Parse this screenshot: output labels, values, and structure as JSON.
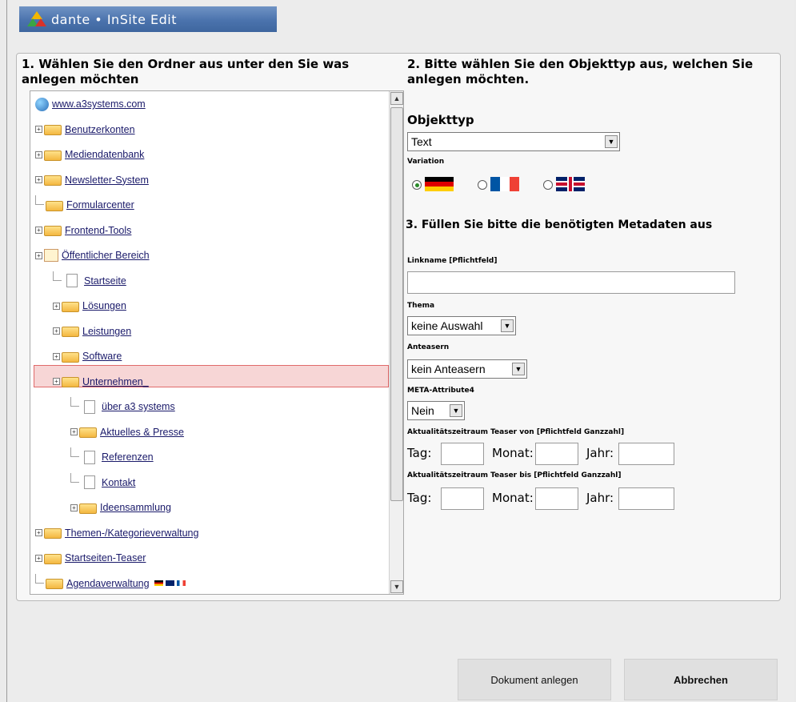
{
  "app": {
    "title": "dante • InSite Edit"
  },
  "left": {
    "title": "1. Wählen Sie den Ordner aus unter den Sie was anlegen möchten",
    "tree": [
      {
        "label": "www.a3systems.com",
        "icon": "globe-icon"
      },
      {
        "label": "Benutzerkonten",
        "icon": "users-icon"
      },
      {
        "label": "Mediendatenbank",
        "icon": "media-icon"
      },
      {
        "label": "Newsletter-System",
        "icon": "folder-icon"
      },
      {
        "label": "Formularcenter",
        "icon": "folder-icon"
      },
      {
        "label": "Frontend-Tools",
        "icon": "tools-icon"
      },
      {
        "label": "Öffentlicher Bereich",
        "icon": "home-icon"
      },
      {
        "label": "Startseite",
        "icon": "page-icon"
      },
      {
        "label": "Lösungen",
        "icon": "folder-icon"
      },
      {
        "label": "Leistungen",
        "icon": "folder-icon"
      },
      {
        "label": "Software",
        "icon": "folder-icon"
      },
      {
        "label": "Unternehmen_",
        "icon": "folder-icon"
      },
      {
        "label": "über a3 systems",
        "icon": "page-icon"
      },
      {
        "label": "Aktuelles & Presse",
        "icon": "folder-icon"
      },
      {
        "label": "Referenzen",
        "icon": "page-icon"
      },
      {
        "label": "Kontakt",
        "icon": "page-icon"
      },
      {
        "label": "Ideensammlung",
        "icon": "folder-icon"
      },
      {
        "label": "Themen-/Kategorieverwaltung",
        "icon": "folder-icon"
      },
      {
        "label": "Startseiten-Teaser",
        "icon": "folder-icon"
      },
      {
        "label": "Agendaverwaltung",
        "icon": "folder-icon"
      }
    ]
  },
  "right": {
    "title": "2. Bitte wählen Sie den Objekttyp aus, welchen Sie anlegen möchten.",
    "objekttyp_label": "Objekttyp",
    "objekttyp_value": "Text",
    "variation_label": "Variation",
    "meta_title": "3. Füllen Sie bitte die benötigten Metadaten aus",
    "linkname_label": "Linkname [Pflichtfeld]",
    "thema_label": "Thema",
    "thema_value": "keine Auswahl",
    "anteasern_label": "Anteasern",
    "anteasern_value": "kein Anteasern",
    "meta_attr_label": "META-Attribute4",
    "meta_attr_value": "Nein",
    "von_label": "Aktualitätszeitraum Teaser von [Pflichtfeld Ganzzahl]",
    "bis_label": "Aktualitätszeitraum Teaser bis [Pflichtfeld Ganzzahl]",
    "tag_label": "Tag:",
    "monat_label": "Monat:",
    "jahr_label": "Jahr:"
  },
  "buttons": {
    "create": "Dokument anlegen",
    "cancel": "Abbrechen"
  }
}
